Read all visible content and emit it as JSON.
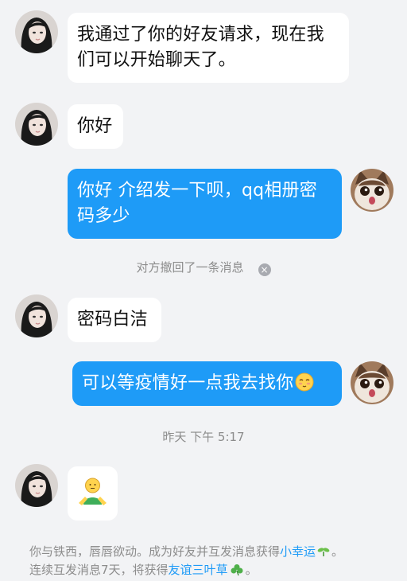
{
  "messages": [
    {
      "side": "in",
      "text": "我通过了你的好友请求，现在我们可以开始聊天了。"
    },
    {
      "side": "in",
      "text": "你好"
    },
    {
      "side": "out",
      "text": "你好 介绍发一下呗，qq相册密码多少"
    },
    {
      "side": "in",
      "text": "密码白洁"
    },
    {
      "side": "out",
      "text": "可以等疫情好一点我去找你"
    }
  ],
  "system": {
    "revoked": "对方撤回了一条消息",
    "timestamp": "昨天 下午 5:17"
  },
  "footer": {
    "line1_prefix": "你与铁西，唇唇欲动。成为好友并互发消息获得",
    "line1_link": "小幸运",
    "line1_suffix": "。",
    "line2_prefix": "连续互发消息7天，将获得",
    "line2_link": "友谊三叶草",
    "line2_suffix": "。"
  },
  "icons": {
    "revoke": "close-circle-icon",
    "blush": "blush-emoji-icon",
    "sticker": "green-figure-sticker-icon",
    "sprout": "sprout-icon",
    "clover": "clover-icon"
  },
  "colors": {
    "outgoing_bubble": "#1e9bf7",
    "incoming_bubble": "#ffffff",
    "background": "#f2f3f5",
    "link": "#1e9bf7"
  }
}
